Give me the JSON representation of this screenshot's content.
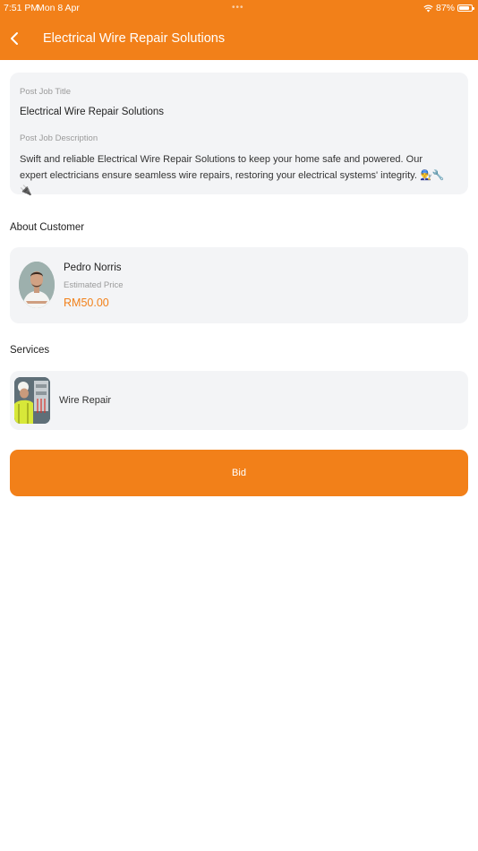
{
  "status_bar": {
    "time": "7:51 PM",
    "date": "Mon 8 Apr",
    "dots": "•••",
    "battery": "87%",
    "battery_level": 0.87
  },
  "header": {
    "title": "Electrical Wire Repair Solutions",
    "back_icon": "chevron-left-icon"
  },
  "job": {
    "title_label": "Post Job Title",
    "title": "Electrical Wire Repair Solutions",
    "description_label": "Post Job Description",
    "description": "Swift and reliable Electrical Wire Repair Solutions to keep your home safe and powered. Our expert electricians ensure seamless wire repairs, restoring your electrical systems' integrity. 👨‍🔧🔧🔌"
  },
  "customer": {
    "section_title": "About Customer",
    "name": "Pedro Norris",
    "estimated_label": "Estimated Price",
    "estimated_price": "RM50.00"
  },
  "services": {
    "section_title": "Services",
    "items": [
      {
        "name": "Wire Repair"
      }
    ]
  },
  "actions": {
    "bid_label": "Bid"
  },
  "colors": {
    "accent": "#f28019",
    "card_background": "#f3f4f6",
    "muted_text": "#9a9a9a"
  }
}
